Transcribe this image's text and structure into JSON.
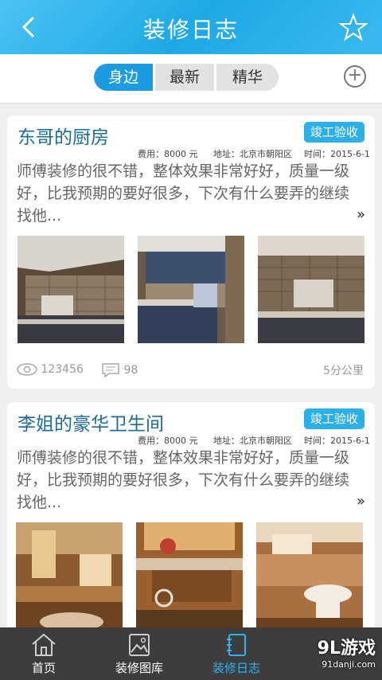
{
  "header": {
    "title": "装修日志"
  },
  "tabs": [
    "身边",
    "最新",
    "精华"
  ],
  "posts": [
    {
      "title": "东哥的厨房",
      "badge": "竣工验收",
      "cost": "费用：8000 元",
      "address": "地址：北京市朝阳区",
      "time": "时间：2015-6-1",
      "desc": "师傅装修的很不错，整体效果非常好好，质量一级好，比我预期的要好很多，下次有什么要弄的继续找他...",
      "views": "123456",
      "comments": "98",
      "distance": "5分公里"
    },
    {
      "title": "李姐的豪华卫生间",
      "badge": "竣工验收",
      "cost": "费用：8000 元",
      "address": "地址：北京市朝阳区",
      "time": "时间：2015-6-1",
      "desc": "师傅装修的很不错，整体效果非常好好，质量一级好，比我预期的要好很多，下次有什么要弄的继续找他..."
    }
  ],
  "nav": [
    {
      "label": "首页"
    },
    {
      "label": "装修图库"
    },
    {
      "label": "装修日志"
    }
  ],
  "watermark": {
    "brand": "9L游戏",
    "url": "91danji.com"
  },
  "colors": {
    "header": "#1ea8e6",
    "active_tab": "#1c9be3",
    "badge": "#2bb0e8",
    "nav_bg": "#3d3d3d"
  }
}
